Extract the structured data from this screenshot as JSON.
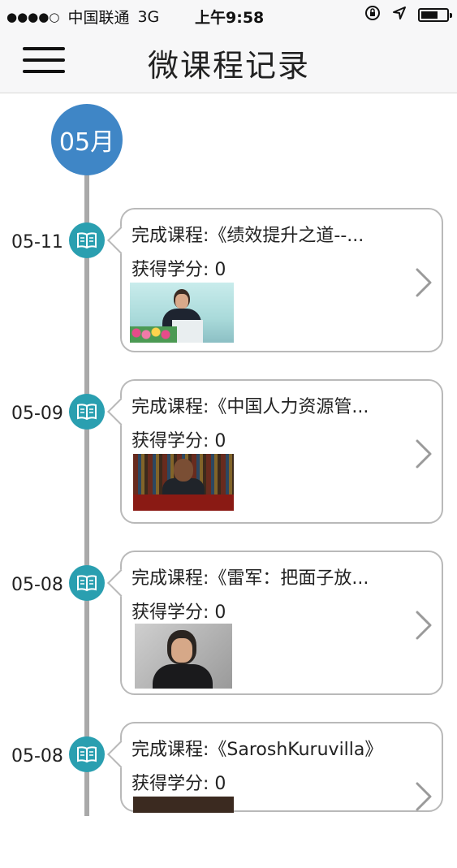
{
  "status_bar": {
    "signal": "●●●●○",
    "carrier": "中国联通",
    "network": "3G",
    "time": "上午9:58"
  },
  "nav": {
    "title": "微课程记录"
  },
  "timeline": {
    "month": "05月",
    "entries": [
      {
        "date": "05-11",
        "title": "完成课程:《绩效提升之道--...",
        "credit": "获得学分: 0"
      },
      {
        "date": "05-09",
        "title": "完成课程:《中国人力资源管...",
        "credit": "获得学分: 0"
      },
      {
        "date": "05-08",
        "title": "完成课程:《雷军：把面子放...",
        "credit": "获得学分: 0"
      },
      {
        "date": "05-08",
        "title": "完成课程:《SaroshKuruvilla》",
        "credit": "获得学分: 0"
      }
    ]
  },
  "colors": {
    "month_badge": "#3f86c6",
    "entry_icon": "#2a9fb0",
    "timeline_line": "#a9a9a9",
    "card_border": "#b9b9b9"
  },
  "icons": {
    "menu": "hamburger-icon",
    "entry": "book-icon",
    "chevron": "chevron-right-icon",
    "lock": "orientation-lock-icon",
    "location": "location-arrow-icon",
    "battery": "battery-icon"
  }
}
